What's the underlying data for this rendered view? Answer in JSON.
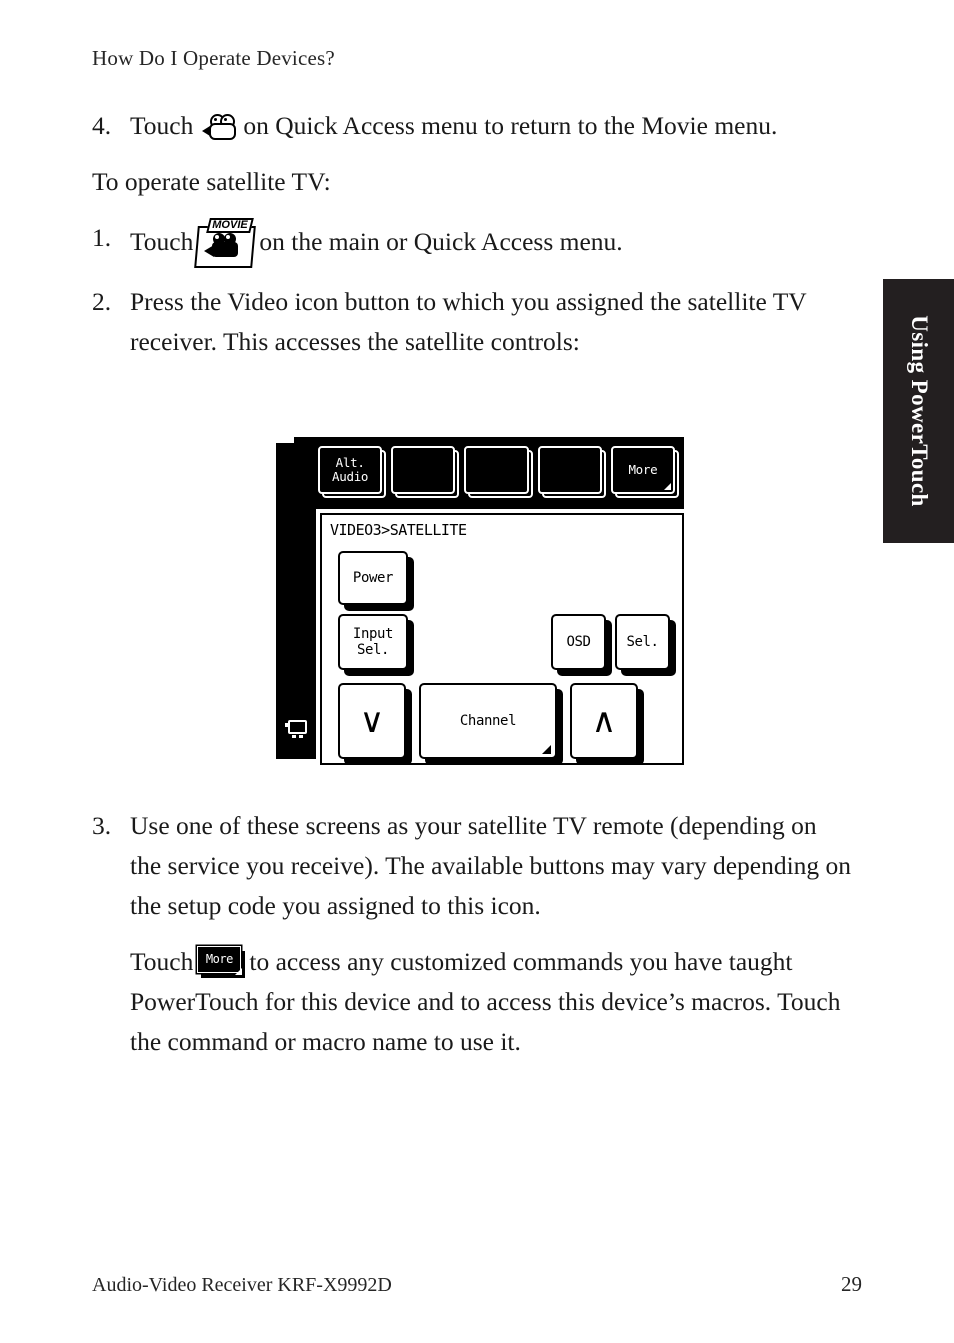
{
  "running_head": "How Do I Operate Devices?",
  "steps": {
    "step4": {
      "num": "4.",
      "text_before": "Touch",
      "icon": "movie-camera-outline-icon",
      "text_after": "on Quick Access menu to return to the Movie menu."
    },
    "lead_in": "To operate satellite TV:",
    "step1": {
      "num": "1.",
      "text_before": "Touch",
      "icon_label": "MOVIE",
      "text_after": "on the main or Quick Access menu."
    },
    "step2": {
      "num": "2.",
      "text": "Press the Video icon button to which you assigned the satellite TV receiver. This accesses the satellite controls:"
    },
    "step3": {
      "num": "3.",
      "text": "Use one of these screens as your satellite TV remote (depending on the service you receive). The available buttons may vary depending on the setup code you assigned to this icon."
    },
    "more_para": {
      "text_before": "Touch",
      "icon_label": "More",
      "text_after": "to access any customized commands you have taught PowerTouch for this device and to access this device’s macros. Touch the command or macro name to use it."
    }
  },
  "lcd": {
    "device_icon": "tv-monitor-icon",
    "top_keys": [
      {
        "label": "Alt.\nAudio",
        "has_corner": false
      },
      {
        "label": "",
        "has_corner": false
      },
      {
        "label": "",
        "has_corner": false
      },
      {
        "label": "",
        "has_corner": false
      },
      {
        "label": "More",
        "has_corner": true
      }
    ],
    "panel_title": "VIDEO3>SATELLITE",
    "keys": {
      "power": "Power",
      "input_sel": "Input\nSel.",
      "osd": "OSD",
      "sel": "Sel.",
      "channel_down": "∨",
      "channel": "Channel",
      "channel_up": "∧"
    }
  },
  "side_tab": "Using PowerTouch",
  "footer": {
    "left": "Audio-Video Receiver KRF-X9992D",
    "page": "29"
  },
  "colors": {
    "ink": "#1a1a1a",
    "tab_background": "#231f20",
    "lcd_black": "#000000",
    "paper": "#ffffff"
  }
}
